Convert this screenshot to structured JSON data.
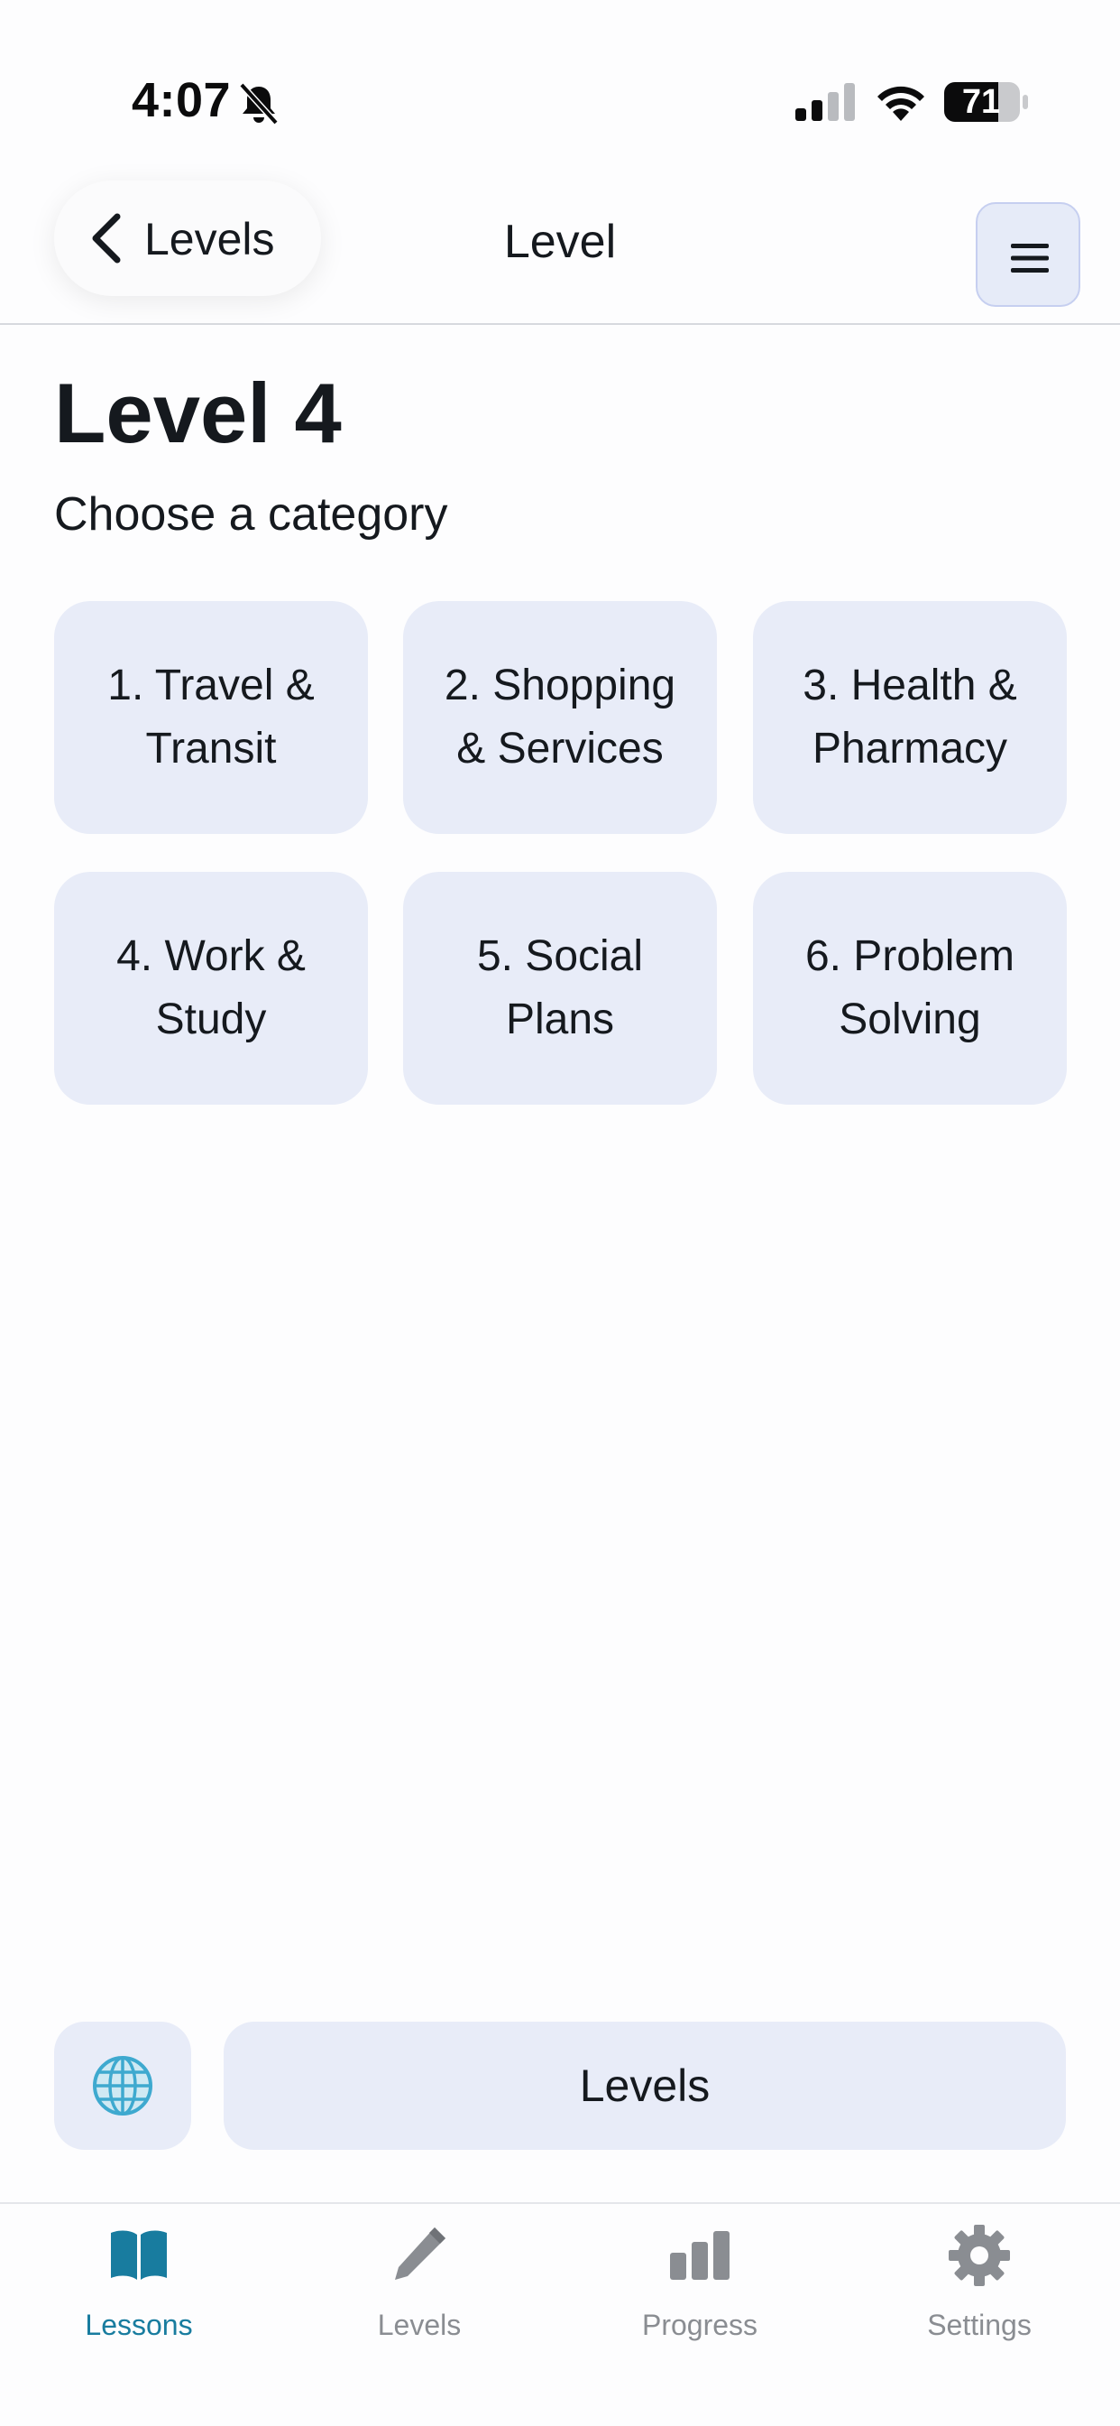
{
  "status_bar": {
    "time": "4:07",
    "battery": "71"
  },
  "nav": {
    "back_label": "Levels",
    "title": "Level"
  },
  "content": {
    "heading": "Level 4",
    "subtitle": "Choose a category",
    "categories": [
      {
        "line1": "1. Travel &",
        "line2": "Transit"
      },
      {
        "line1": "2. Shopping",
        "line2": "& Services"
      },
      {
        "line1": "3. Health &",
        "line2": "Pharmacy"
      },
      {
        "line1": "4. Work &",
        "line2": "Study"
      },
      {
        "line1": "5. Social",
        "line2": "Plans"
      },
      {
        "line1": "6. Problem",
        "line2": "Solving"
      }
    ]
  },
  "bottom_actions": {
    "levels_button": "Levels"
  },
  "tabs": [
    {
      "label": "Lessons",
      "icon": "book-icon",
      "active": true
    },
    {
      "label": "Levels",
      "icon": "pencil-icon",
      "active": false
    },
    {
      "label": "Progress",
      "icon": "bar-chart-icon",
      "active": false
    },
    {
      "label": "Settings",
      "icon": "gear-icon",
      "active": false
    }
  ],
  "colors": {
    "accent": "#187c9f",
    "card_background": "#e8ecf8",
    "inactive_tab": "#8a8d92"
  }
}
